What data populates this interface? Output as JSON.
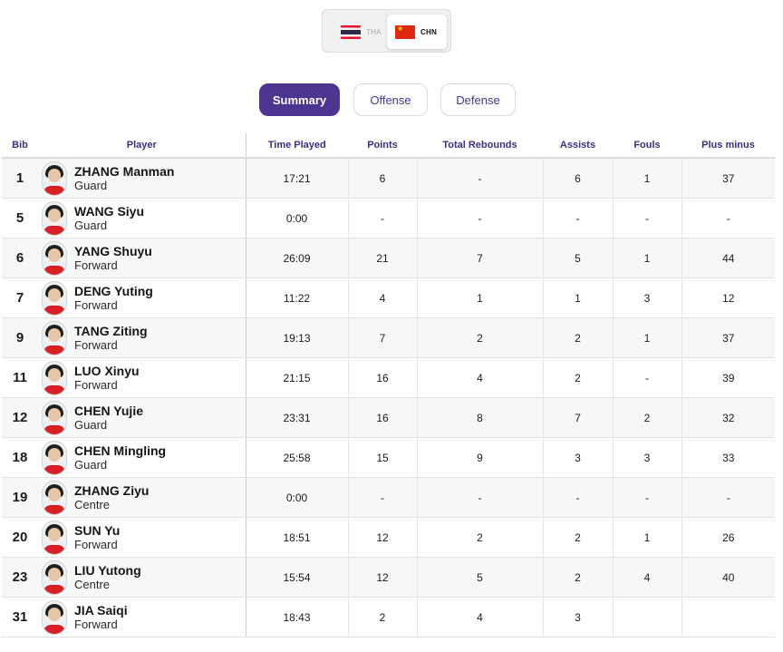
{
  "teams": {
    "tha": {
      "code": "THA"
    },
    "chn": {
      "code": "CHN"
    }
  },
  "tabs": [
    {
      "label": "Summary"
    },
    {
      "label": "Offense"
    },
    {
      "label": "Defense"
    }
  ],
  "columns": [
    "Bib",
    "Player",
    "Time Played",
    "Points",
    "Total Rebounds",
    "Assists",
    "Fouls",
    "Plus minus"
  ],
  "players": [
    {
      "bib": "1",
      "name": "ZHANG Manman",
      "position": "Guard",
      "time": "17:21",
      "points": "6",
      "rebounds": "-",
      "assists": "6",
      "fouls": "1",
      "plus_minus": "37"
    },
    {
      "bib": "5",
      "name": "WANG Siyu",
      "position": "Guard",
      "time": "0:00",
      "points": "-",
      "rebounds": "-",
      "assists": "-",
      "fouls": "-",
      "plus_minus": "-"
    },
    {
      "bib": "6",
      "name": "YANG Shuyu",
      "position": "Forward",
      "time": "26:09",
      "points": "21",
      "rebounds": "7",
      "assists": "5",
      "fouls": "1",
      "plus_minus": "44"
    },
    {
      "bib": "7",
      "name": "DENG Yuting",
      "position": "Forward",
      "time": "11:22",
      "points": "4",
      "rebounds": "1",
      "assists": "1",
      "fouls": "3",
      "plus_minus": "12"
    },
    {
      "bib": "9",
      "name": "TANG Ziting",
      "position": "Forward",
      "time": "19:13",
      "points": "7",
      "rebounds": "2",
      "assists": "2",
      "fouls": "1",
      "plus_minus": "37"
    },
    {
      "bib": "11",
      "name": "LUO Xinyu",
      "position": "Forward",
      "time": "21:15",
      "points": "16",
      "rebounds": "4",
      "assists": "2",
      "fouls": "-",
      "plus_minus": "39"
    },
    {
      "bib": "12",
      "name": "CHEN Yujie",
      "position": "Guard",
      "time": "23:31",
      "points": "16",
      "rebounds": "8",
      "assists": "7",
      "fouls": "2",
      "plus_minus": "32"
    },
    {
      "bib": "18",
      "name": "CHEN Mingling",
      "position": "Guard",
      "time": "25:58",
      "points": "15",
      "rebounds": "9",
      "assists": "3",
      "fouls": "3",
      "plus_minus": "33"
    },
    {
      "bib": "19",
      "name": "ZHANG Ziyu",
      "position": "Centre",
      "time": "0:00",
      "points": "-",
      "rebounds": "-",
      "assists": "-",
      "fouls": "-",
      "plus_minus": "-"
    },
    {
      "bib": "20",
      "name": "SUN Yu",
      "position": "Forward",
      "time": "18:51",
      "points": "12",
      "rebounds": "2",
      "assists": "2",
      "fouls": "1",
      "plus_minus": "26"
    },
    {
      "bib": "23",
      "name": "LIU Yutong",
      "position": "Centre",
      "time": "15:54",
      "points": "12",
      "rebounds": "5",
      "assists": "2",
      "fouls": "4",
      "plus_minus": "40"
    },
    {
      "bib": "31",
      "name": "JIA Saiqi",
      "position": "Forward",
      "time": "18:43",
      "points": "2",
      "rebounds": "4",
      "assists": "3",
      "fouls": "",
      "plus_minus": ""
    }
  ],
  "colors": {
    "accent": "#4b3591",
    "header_text": "#3e2e87",
    "flag_red": "#de2910"
  }
}
